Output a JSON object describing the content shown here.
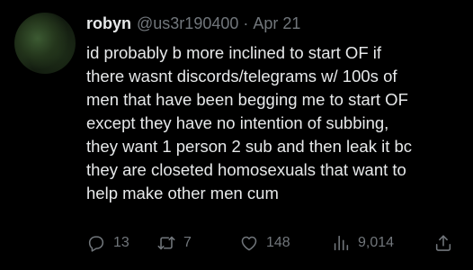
{
  "tweet": {
    "author": {
      "display_name": "robyn",
      "handle": "@us3r190400",
      "separator": "·",
      "date": "Apr 21"
    },
    "text_lines": [
      "id probably b more inclined to start OF if",
      "there wasnt discords/telegrams w/ 100s of",
      "men that have been begging me to start OF",
      "except they have no intention of subbing,",
      "they want 1 person 2 sub and then leak it bc",
      "they are closeted homosexuals that want to",
      "help make other men cum"
    ],
    "actions": {
      "replies": "13",
      "reposts": "7",
      "likes": "148",
      "views": "9,014"
    }
  },
  "colors": {
    "background": "#000000",
    "text_primary": "#e7e9ea",
    "text_secondary": "#71767b"
  },
  "icons": [
    "reply-icon",
    "repost-icon",
    "like-icon",
    "views-icon",
    "share-icon"
  ]
}
